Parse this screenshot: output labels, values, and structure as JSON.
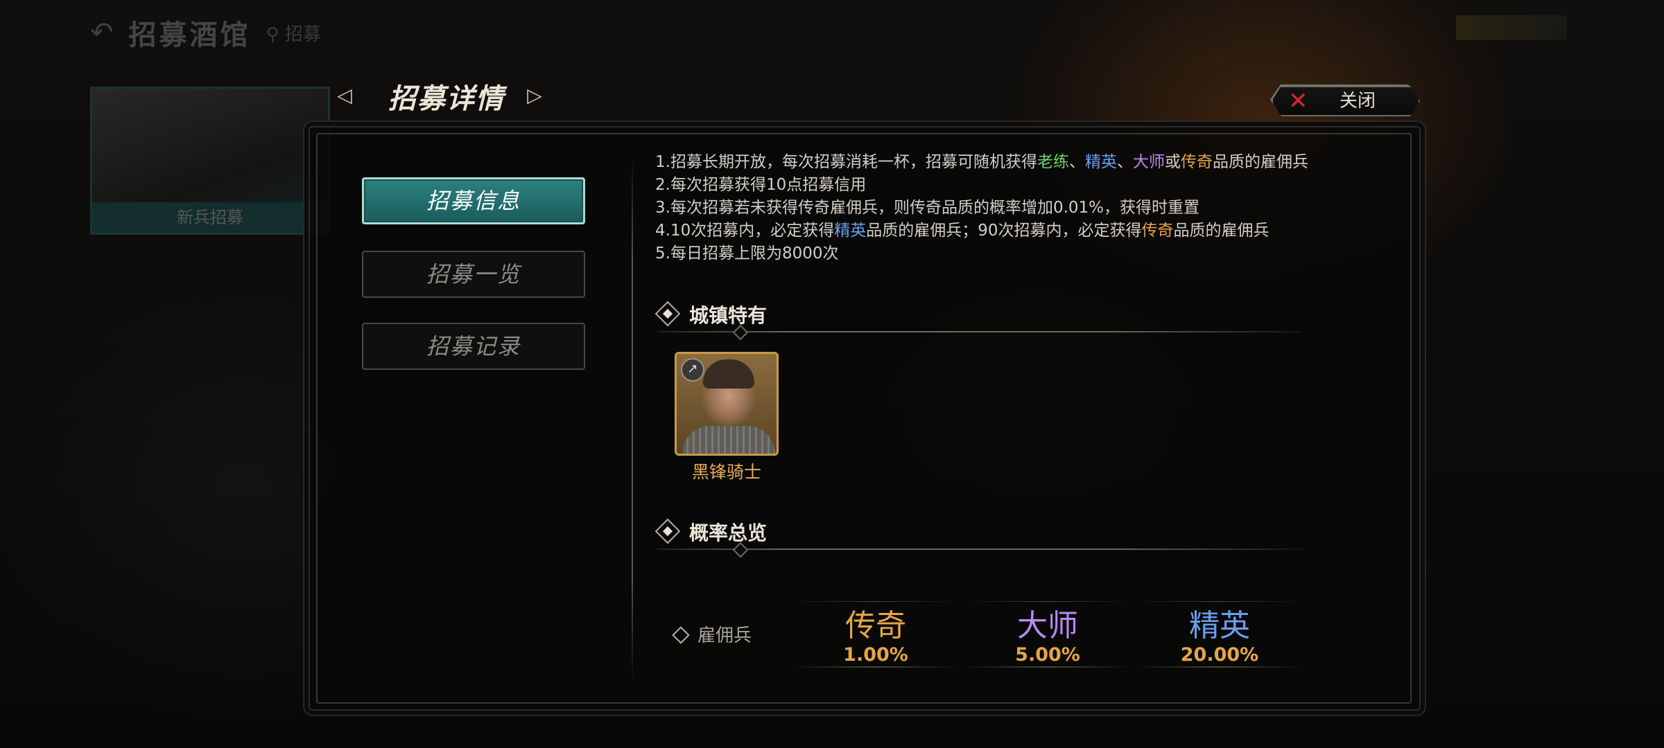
{
  "background": {
    "back_arrow": "↶",
    "title": "招募酒馆",
    "subtitle": "⚲ 招募",
    "card_label": "新兵招募"
  },
  "header": {
    "title": "招募详情",
    "prev_arrow": "◁",
    "next_arrow": "▷",
    "close_icon": "✕",
    "close_label": "关闭"
  },
  "tabs": [
    {
      "label": "招募信息",
      "active": true
    },
    {
      "label": "招募一览",
      "active": false
    },
    {
      "label": "招募记录",
      "active": false
    }
  ],
  "rules": {
    "line1": {
      "prefix": "1.招募长期开放，每次招募消耗一杯，招募可随机获得",
      "veteran": "老练",
      "sep1": "、",
      "elite": "精英",
      "sep2": "、",
      "master": "大师",
      "or": "或",
      "legend": "传奇",
      "suffix": "品质的雇佣兵"
    },
    "line2": "2.每次招募获得10点招募信用",
    "line3": "3.每次招募若未获得传奇雇佣兵，则传奇品质的概率增加0.01%，获得时重置",
    "line4": {
      "prefix": "4.10次招募内，必定获得",
      "elite": "精英",
      "middle": "品质的雇佣兵；90次招募内，必定获得",
      "legend": "传奇",
      "suffix": "品质的雇佣兵"
    },
    "line5": "5.每日招募上限为8000次"
  },
  "town_section": {
    "title": "城镇特有",
    "unit": {
      "name": "黑锋骑士",
      "class_icon": "spear-icon",
      "class_glyph": "↗"
    }
  },
  "probability_section": {
    "title": "概率总览",
    "row_label": "雇佣兵",
    "rarities": [
      {
        "name": "传奇",
        "value": "1.00%",
        "color": "#e6a544"
      },
      {
        "name": "大师",
        "value": "5.00%",
        "color": "#b98af0"
      },
      {
        "name": "精英",
        "value": "20.00%",
        "color": "#6a9ff0"
      }
    ]
  },
  "colors": {
    "veteran": "#6fd26a",
    "elite": "#6a9ff0",
    "master": "#b98af0",
    "legend": "#e6a544",
    "active_tab": "#2d8080",
    "close_x": "#d8242c"
  }
}
